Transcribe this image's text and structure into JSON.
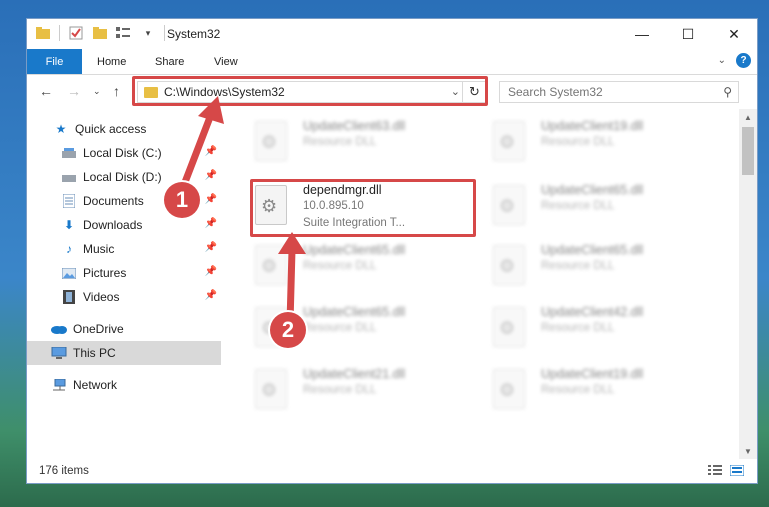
{
  "window": {
    "title": "System32"
  },
  "window_controls": {
    "minimize": "—",
    "maximize": "☐",
    "close": "✕"
  },
  "ribbon": {
    "tabs": [
      {
        "label": "File"
      },
      {
        "label": "Home"
      },
      {
        "label": "Share"
      },
      {
        "label": "View"
      }
    ],
    "help": "?"
  },
  "navigation": {
    "address": "C:\\Windows\\System32",
    "search_placeholder": "Search System32"
  },
  "sidebar": {
    "items": [
      {
        "label": "Quick access",
        "icon": "star-icon",
        "pinned": false
      },
      {
        "label": "Local Disk (C:)",
        "icon": "drive-icon",
        "pinned": true
      },
      {
        "label": "Local Disk (D:)",
        "icon": "drive-icon",
        "pinned": true
      },
      {
        "label": "Documents",
        "icon": "documents-icon",
        "pinned": true
      },
      {
        "label": "Downloads",
        "icon": "download-icon",
        "pinned": true
      },
      {
        "label": "Music",
        "icon": "music-icon",
        "pinned": true
      },
      {
        "label": "Pictures",
        "icon": "pictures-icon",
        "pinned": true
      },
      {
        "label": "Videos",
        "icon": "videos-icon",
        "pinned": true
      },
      {
        "label": "OneDrive",
        "icon": "cloud-icon",
        "pinned": false
      },
      {
        "label": "This PC",
        "icon": "computer-icon",
        "pinned": false,
        "selected": true
      },
      {
        "label": "Network",
        "icon": "network-icon",
        "pinned": false
      }
    ]
  },
  "files": {
    "highlighted": {
      "name": "dependmgr.dll",
      "version": "10.0.895.10",
      "description": "Suite Integration T..."
    },
    "blurred": [
      {
        "name": "UpdateClient63.dll",
        "type": "Resource DLL"
      },
      {
        "name": "UpdateClient19.dll",
        "type": "Resource DLL"
      },
      {
        "name": "UpdateClient65.dll",
        "type": "Resource DLL"
      },
      {
        "name": "UpdateClient65.dll",
        "type": "Resource DLL"
      },
      {
        "name": "UpdateClient65.dll",
        "type": "Resource DLL"
      },
      {
        "name": "UpdateClient65.dll",
        "type": "Resource DLL"
      },
      {
        "name": "UpdateClient42.dll",
        "type": "Resource DLL"
      },
      {
        "name": "UpdateClient21.dll",
        "type": "Resource DLL"
      },
      {
        "name": "UpdateClient19.dll",
        "type": "Resource DLL"
      }
    ]
  },
  "status": {
    "items_count": "176 items"
  },
  "annotations": {
    "step1": "1",
    "step2": "2"
  },
  "colors": {
    "accent": "#1979ca",
    "highlight": "#d64848",
    "folder": "#e8bf44"
  }
}
